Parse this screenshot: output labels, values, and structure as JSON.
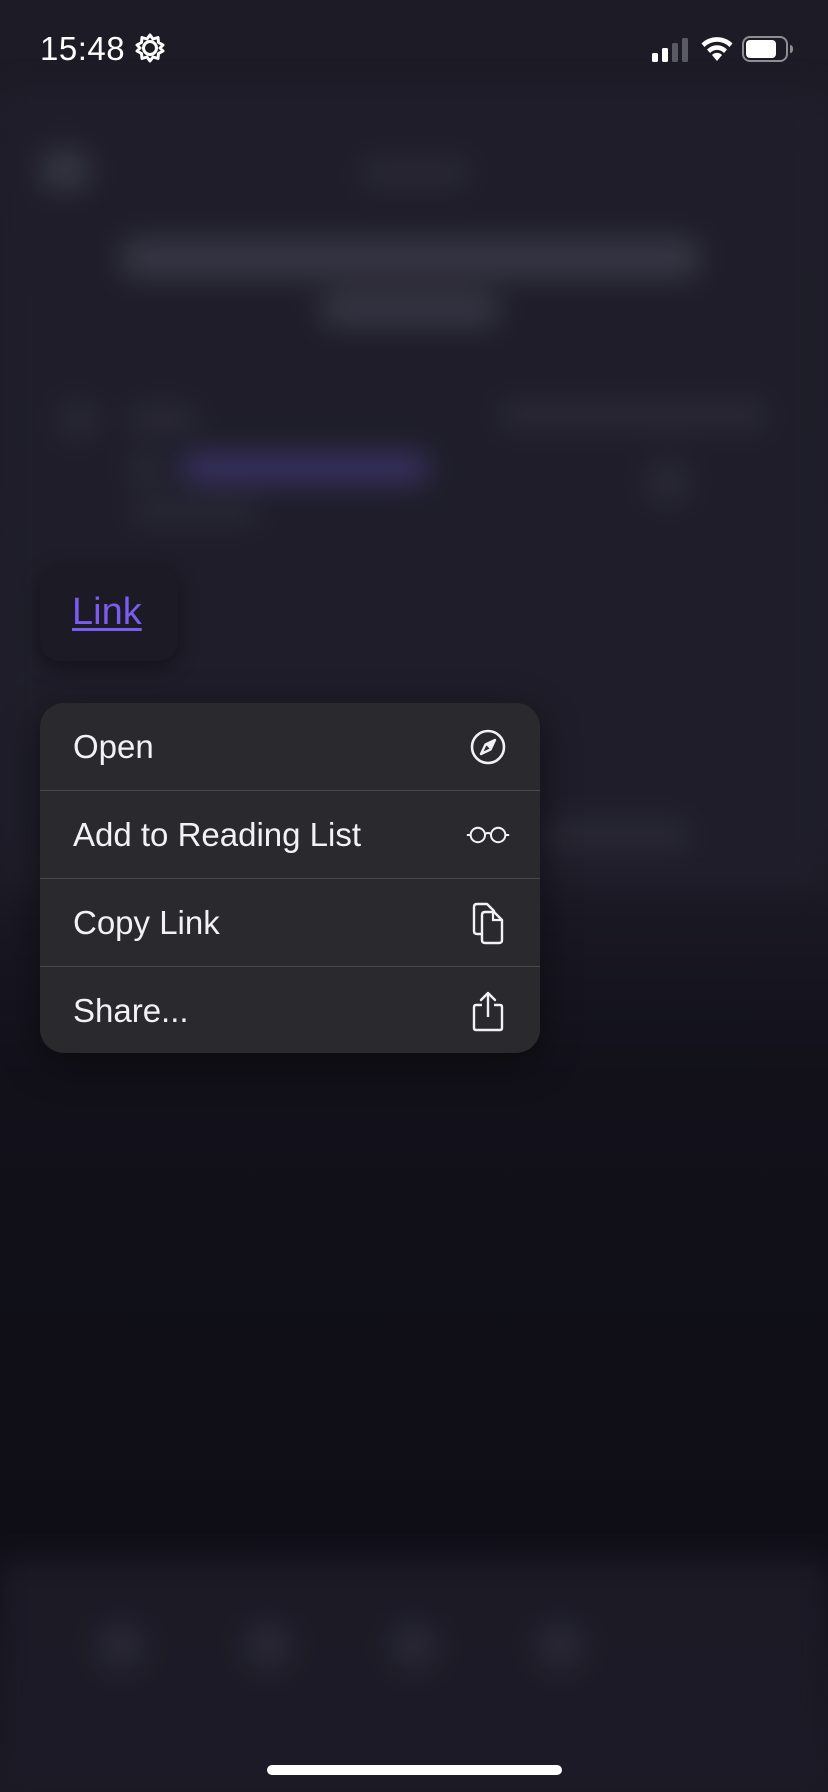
{
  "status_bar": {
    "time": "15:48",
    "settings_icon": "gear-icon",
    "signal_icon": "cellular-signal-icon",
    "wifi_icon": "wifi-icon",
    "battery_icon": "battery-icon"
  },
  "link_preview": {
    "label": "Link",
    "color": "#7b5cf0"
  },
  "context_menu": {
    "items": [
      {
        "label": "Open",
        "icon": "compass-icon"
      },
      {
        "label": "Add to Reading List",
        "icon": "glasses-icon"
      },
      {
        "label": "Copy Link",
        "icon": "copy-icon"
      },
      {
        "label": "Share...",
        "icon": "share-icon"
      }
    ]
  }
}
